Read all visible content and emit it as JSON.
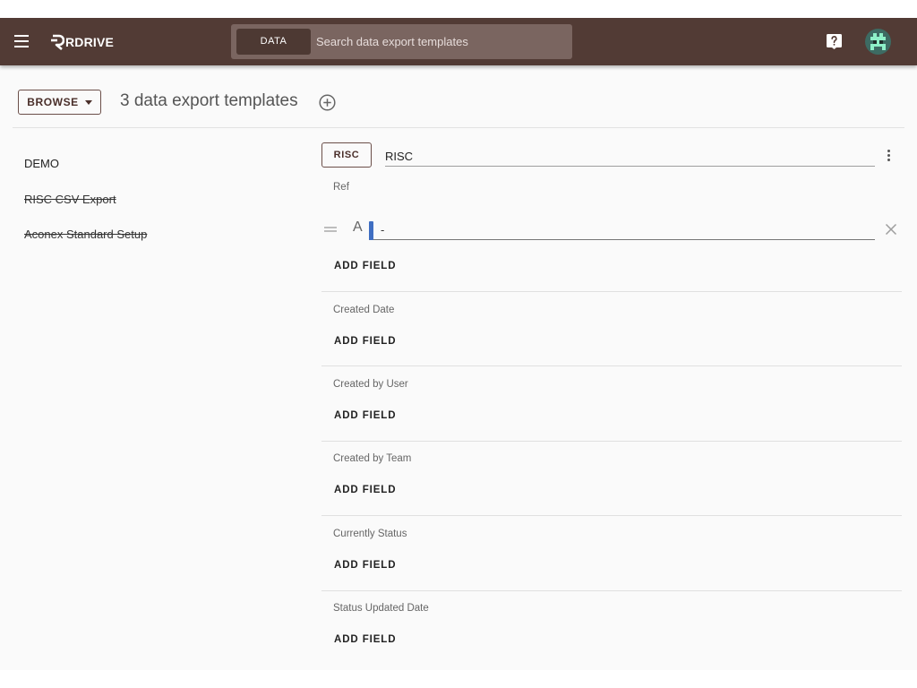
{
  "header": {
    "logo_text": "RDRIVE",
    "search_chip": "DATA",
    "search_placeholder": "Search data export templates"
  },
  "toolbar": {
    "browse_label": "BROWSE",
    "heading": "3 data export templates"
  },
  "templates": [
    {
      "name": "DEMO",
      "struck": false
    },
    {
      "name": "RISC CSV Export",
      "struck": true
    },
    {
      "name": "Aconex Standard Setup",
      "struck": true
    }
  ],
  "editor": {
    "chip_label": "RISC",
    "template_name": "RISC",
    "field_type": "A",
    "field_value": "-",
    "add_field_label": "ADD FIELD",
    "sections": [
      "Ref",
      "Created Date",
      "Created by User",
      "Created by Team",
      "Currently Status",
      "Status Updated Date"
    ]
  },
  "colors": {
    "header_bg": "#523b35",
    "search_bg": "#7a6560",
    "accent_cursor": "#3f6ec2"
  },
  "icons": [
    "menu-icon",
    "help-icon",
    "avatar-icon",
    "add-circle-icon",
    "caret-down-icon",
    "more-vert-icon",
    "drag-handle-icon",
    "close-icon"
  ]
}
